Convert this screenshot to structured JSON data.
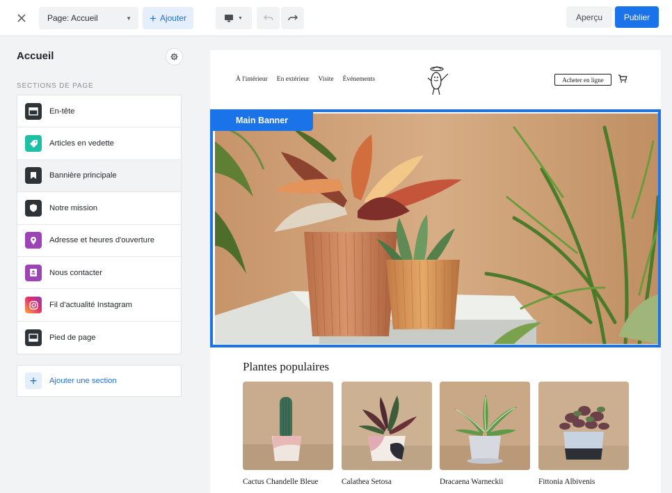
{
  "toolbar": {
    "page_select": "Page: Accueil",
    "add_label": "Ajouter",
    "preview_label": "Aperçu",
    "publish_label": "Publier"
  },
  "sidebar": {
    "title": "Accueil",
    "section_caption": "SECTIONS DE PAGE",
    "items": [
      {
        "label": "En-tête",
        "icon": "header-icon",
        "color": "#2e3338"
      },
      {
        "label": "Articles en vedette",
        "icon": "tag-icon",
        "color": "#1fbfa6"
      },
      {
        "label": "Bannière principale",
        "icon": "bookmark-icon",
        "color": "#2e3338"
      },
      {
        "label": "Notre mission",
        "icon": "shield-icon",
        "color": "#2e3338"
      },
      {
        "label": "Adresse et heures d'ouverture",
        "icon": "location-pin-icon",
        "color": "#9c44b5"
      },
      {
        "label": "Nous contacter",
        "icon": "contact-card-icon",
        "color": "#9c44b5"
      },
      {
        "label": "Fil d'actualité Instagram",
        "icon": "instagram-icon",
        "color": "#e1306c"
      },
      {
        "label": "Pied de page",
        "icon": "footer-icon",
        "color": "#2e3338"
      }
    ],
    "add_section_label": "Ajouter une section"
  },
  "site": {
    "nav": [
      "À l'intérieur",
      "En extérieur",
      "Visite",
      "Événements"
    ],
    "shop_button": "Acheter en ligne",
    "banner_tag": "Main Banner",
    "popular_title": "Plantes populaires",
    "products": [
      {
        "name": "Cactus Chandelle Bleue"
      },
      {
        "name": "Calathea Setosa"
      },
      {
        "name": "Dracaena Warneckii"
      },
      {
        "name": "Fittonia Albivenis"
      }
    ]
  },
  "colors": {
    "accent": "#1a73e8",
    "accent_light": "#e5eefb"
  }
}
